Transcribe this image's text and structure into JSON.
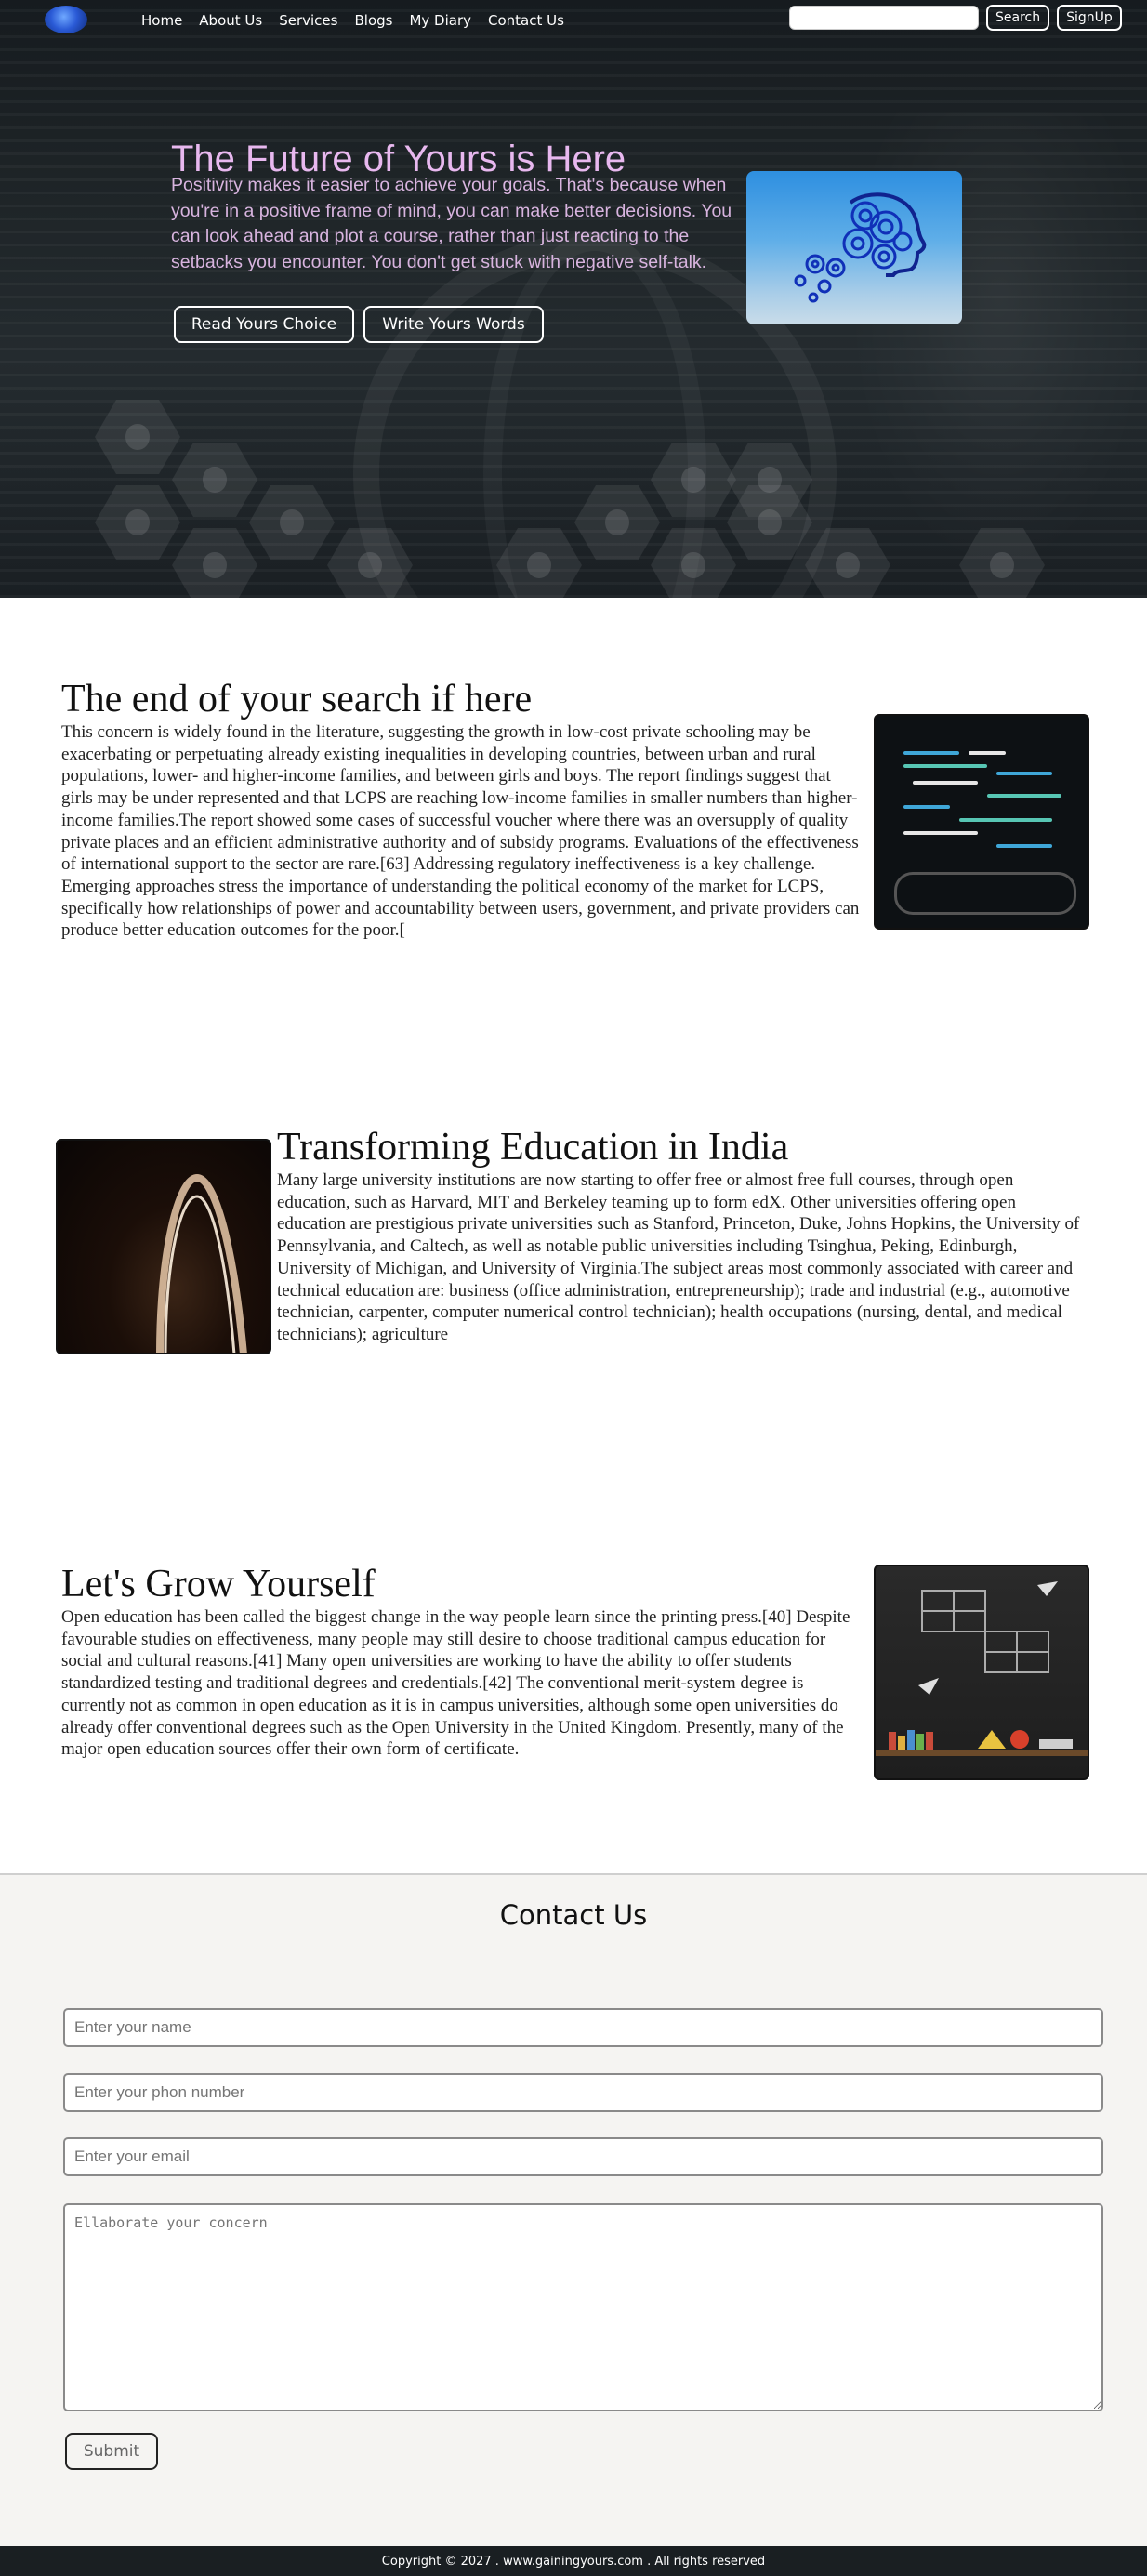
{
  "nav": {
    "links": [
      "Home",
      "About Us",
      "Services",
      "Blogs",
      "My Diary",
      "Contact Us"
    ],
    "search_placeholder": "",
    "search_button": "Search",
    "signup_button": "SignUp"
  },
  "hero": {
    "title": "The Future of Yours is Here",
    "text": "Positivity makes it easier to achieve your goals. That's because when you're in a positive frame of mind, you can make better decisions. You can look ahead and plot a course, rather than just reacting to the setbacks you encounter. You don't get stuck with negative self-talk.",
    "button_primary": "Read Yours Choice",
    "button_secondary": "Write Yours Words"
  },
  "sections": [
    {
      "title": "The end of your search if here",
      "text": "This concern is widely found in the literature, suggesting the growth in low-cost private schooling may be exacerbating or perpetuating already existing inequalities in developing countries, between urban and rural populations, lower- and higher-income families, and between girls and boys. The report findings suggest that girls may be under represented and that LCPS are reaching low-income families in smaller numbers than higher-income families.The report showed some cases of successful voucher where there was an oversupply of quality private places and an efficient administrative authority and of subsidy programs. Evaluations of the effectiveness of international support to the sector are rare.[63] Addressing regulatory ineffectiveness is a key challenge. Emerging approaches stress the importance of understanding the political economy of the market for LCPS, specifically how relationships of power and accountability between users, government, and private providers can produce better education outcomes for the poor.["
    },
    {
      "title": "Transforming Education in India",
      "text": "Many large university institutions are now starting to offer free or almost free full courses, through open education, such as Harvard, MIT and Berkeley teaming up to form edX. Other universities offering open education are prestigious private universities such as Stanford, Princeton, Duke, Johns Hopkins, the University of Pennsylvania, and Caltech, as well as notable public universities including Tsinghua, Peking, Edinburgh, University of Michigan, and University of Virginia.The subject areas most commonly associated with career and technical education are: business (office administration, entrepreneurship); trade and industrial (e.g., automotive technician, carpenter, computer numerical control technician); health occupations (nursing, dental, and medical technicians); agriculture"
    },
    {
      "title": "Let's Grow Yourself",
      "text": "Open education has been called the biggest change in the way people learn since the printing press.[40] Despite favourable studies on effectiveness, many people may still desire to choose traditional campus education for social and cultural reasons.[41] Many open universities are working to have the ability to offer students standardized testing and traditional degrees and credentials.[42] The conventional merit-system degree is currently not as common in open education as it is in campus universities, although some open universities do already offer conventional degrees such as the Open University in the United Kingdom. Presently, many of the major open education sources offer their own form of certificate."
    }
  ],
  "contact": {
    "title": "Contact Us",
    "name_placeholder": "Enter your name",
    "phone_placeholder": "Enter your phon number",
    "email_placeholder": "Enter your email",
    "concern_placeholder": "Ellaborate your concern",
    "submit_label": "Submit"
  },
  "footer": {
    "text": "Copyright © 2027 . www.gainingyours.com . All rights reserved"
  },
  "colors": {
    "hero_text": "#d8b4df",
    "hero_title": "#e8b8ef",
    "footer_bg": "#1a1f22",
    "contact_bg": "#f5f4f2"
  },
  "icons": [
    "logo-icon",
    "gears-head-icon"
  ]
}
